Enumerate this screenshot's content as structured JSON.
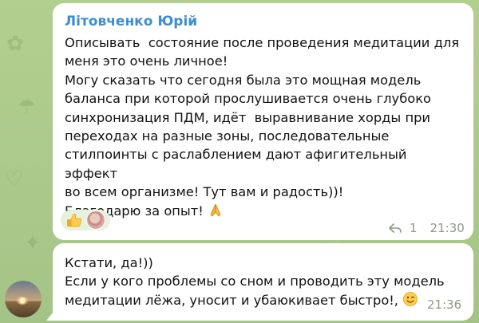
{
  "messages": [
    {
      "sender": "Літовченко Юрій",
      "lines": [
        "Описывать  состояние после проведения медитации для",
        "меня это очень личное!",
        "Могу сказать что сегодня была это мощная модель",
        "баланса при которой прослушивается очень глубоко",
        "синхронизация ПДМ, идёт  выравнивание хорды при",
        "переходах на разные зоны, последовательные",
        "стилпоинты с раслаблением дают афигительный  эффект",
        "во всем организме! Тут вам и радость))!",
        "Благодарю за опыт! "
      ],
      "trailing_emoji": "folded-hands",
      "reactions": [
        {
          "emoji": "thumbs-up"
        },
        {
          "avatar": "reactor-avatar"
        }
      ],
      "reply_count": "1",
      "time": "21:30"
    },
    {
      "lines": [
        "Кстати, да!))",
        "Если у кого проблемы со сном и проводить эту модель",
        "медитации лёжа, уносит и убаюкивает быстро!, "
      ],
      "trailing_emoji": "winking-face",
      "time": "21:36"
    }
  ],
  "colors": {
    "background": "#a9c98c",
    "bubble": "#ffffff",
    "sender_name": "#3d8ed0",
    "meta_text": "#8b9a86",
    "reaction_bg": "#e7f2dc"
  }
}
